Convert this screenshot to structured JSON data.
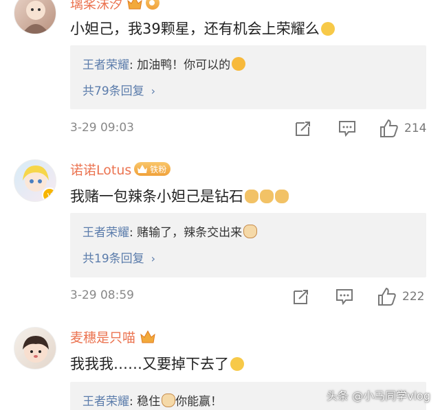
{
  "comments": [
    {
      "username": "璃桨沫汐",
      "text": "小妲己，我39颗星，还有机会上荣耀么",
      "reply_author": "王者荣耀",
      "reply_text": ": 加油鸭！你可以的",
      "reply_count_label": "共79条回复",
      "time": "3-29 09:03",
      "like_count": "214"
    },
    {
      "username": "诺诺Lotus",
      "fan_badge": "铁粉",
      "text": "我赌一包辣条小妲己是钻石",
      "reply_author": "王者荣耀",
      "reply_text": ": 赌输了，辣条交出来",
      "reply_count_label": "共19条回复",
      "time": "3-29 08:59",
      "like_count": "222"
    },
    {
      "username": "麦穗是只喵",
      "text": "我我我……又要掉下去了",
      "reply_author": "王者荣耀",
      "reply_text_a": ": 稳住",
      "reply_text_b": "你能赢！"
    }
  ],
  "watermark": "头条 @小马同学vlog",
  "colors": {
    "username": "#eb7350",
    "reply_author": "#5b7cab",
    "reply_bg": "#f2f2f2",
    "meta": "#888888"
  }
}
